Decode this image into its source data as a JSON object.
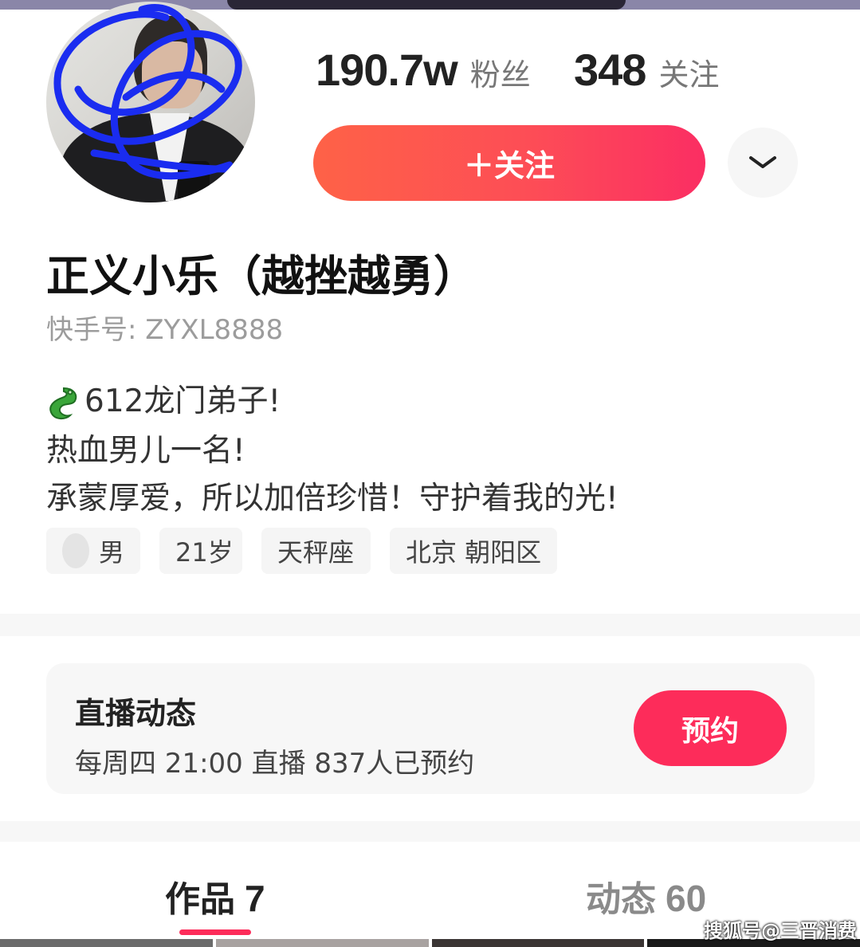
{
  "profile": {
    "fans_count": "190.7w",
    "fans_label": "粉丝",
    "follow_count": "348",
    "follow_label": "关注",
    "follow_button": "＋关注",
    "name": "正义小乐（越挫越勇）",
    "kuaishou_id": "快手号: ZYXL8888",
    "bio": {
      "line1": "612龙门弟子!",
      "line2": "热血男儿一名!",
      "line3": "承蒙厚爱，所以加倍珍惜！守护着我的光!"
    },
    "tags": {
      "gender": "男",
      "age": "21岁",
      "zodiac": "天秤座",
      "location": "北京 朝阳区"
    }
  },
  "live": {
    "title": "直播动态",
    "schedule": "每周四 21:00 直播 837人已预约",
    "reserve_button": "预约"
  },
  "tabs": {
    "works_label": "作品",
    "works_count": "7",
    "moments_label": "动态",
    "moments_count": "60"
  },
  "watermark": "搜狐号@三晋消费",
  "colors": {
    "accent": "#fd2c5a",
    "follow_gradient_start": "#fe6247",
    "follow_gradient_end": "#fb2e63",
    "scribble": "#1a2cf0"
  }
}
